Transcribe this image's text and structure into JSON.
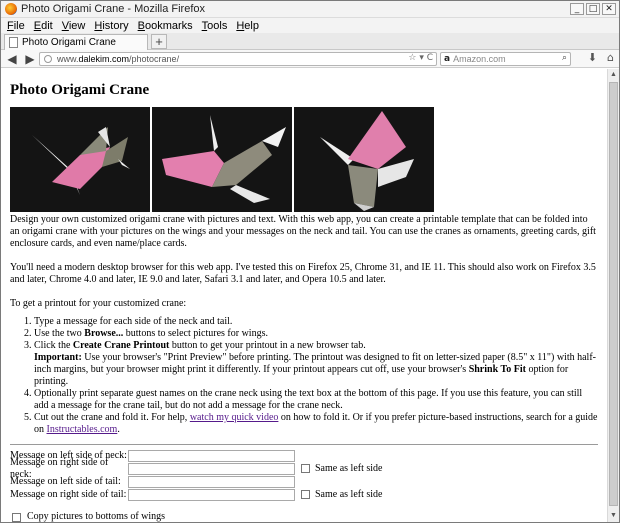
{
  "window": {
    "title": "Photo Origami Crane - Mozilla Firefox",
    "controls": {
      "minimize": "_",
      "maximize": "□",
      "close": "✕"
    }
  },
  "menu": [
    "File",
    "Edit",
    "View",
    "History",
    "Bookmarks",
    "Tools",
    "Help"
  ],
  "tab": {
    "label": "Photo Origami Crane",
    "new_tab": "+"
  },
  "nav": {
    "url_prefix": "www.",
    "url_host": "dalekim.com",
    "url_path": "/photocrane/",
    "url_actions": "☆ ▾ C",
    "search_engine": "a",
    "search_placeholder": "Amazon.com",
    "search_icon": "⌕",
    "icons": [
      "back-arrow-icon",
      "forward-arrow-icon",
      "download-icon",
      "home-icon"
    ]
  },
  "page": {
    "heading": "Photo Origami Crane",
    "photos": [
      "crane-photo-1",
      "crane-photo-2",
      "crane-photo-3"
    ],
    "intro": "Design your own customized origami crane with pictures and text. With this web app, you can create a printable template that can be folded into an origami crane with your pictures on the wings and your messages on the neck and tail. You can use the cranes as ornaments, greeting cards, gift enclosure cards, and even name/place cards.",
    "browser_note": "You'll need a modern desktop browser for this web app. I've tested this on Firefox 25, Chrome 31, and IE 11. This should also work on Firefox 3.5 and later, Chrome 4.0 and later, IE 9.0 and later, Safari 3.1 and later, and Opera 10.5 and later.",
    "steps_intro": "To get a printout for your customized crane:",
    "steps": {
      "s1": "Type a message for each side of the neck and tail.",
      "s2_pre": "Use the two ",
      "s2_bold": "Browse...",
      "s2_post": " buttons to select pictures for wings.",
      "s3_pre": "Click the ",
      "s3_bold": "Create Crane Printout",
      "s3_post": " button to get your printout in a new browser tab.",
      "s3_important": "Important:",
      "s3_imp_text": " Use your browser's \"Print Preview\" before printing. The printout was designed to fit on letter-sized paper (8.5\" x 11\") with half-inch margins, but your browser might print it differently. If your printout appears cut off, use your browser's ",
      "s3_shrink": "Shrink To Fit",
      "s3_end": " option for printing.",
      "s4": "Optionally print separate guest names on the crane neck using the text box at the bottom of this page. If you use this feature, you can still add a message for the crane tail, but do not add a message for the crane neck.",
      "s5_pre": "Cut out the crane and fold it. For help, ",
      "s5_link": "watch my quick video",
      "s5_mid": " on how to fold it. Or if you prefer picture-based instructions, search for a guide on ",
      "s5_link2": "Instructables.com",
      "s5_end": "."
    },
    "form": {
      "neck_left_label": "Message on left side of neck:",
      "neck_right_label": "Message on right side of neck:",
      "tail_left_label": "Message on left side of tail:",
      "tail_right_label": "Message on right side of tail:",
      "same_as_left": "Same as left side",
      "copy_pictures": "Copy pictures to bottoms of wings"
    }
  }
}
